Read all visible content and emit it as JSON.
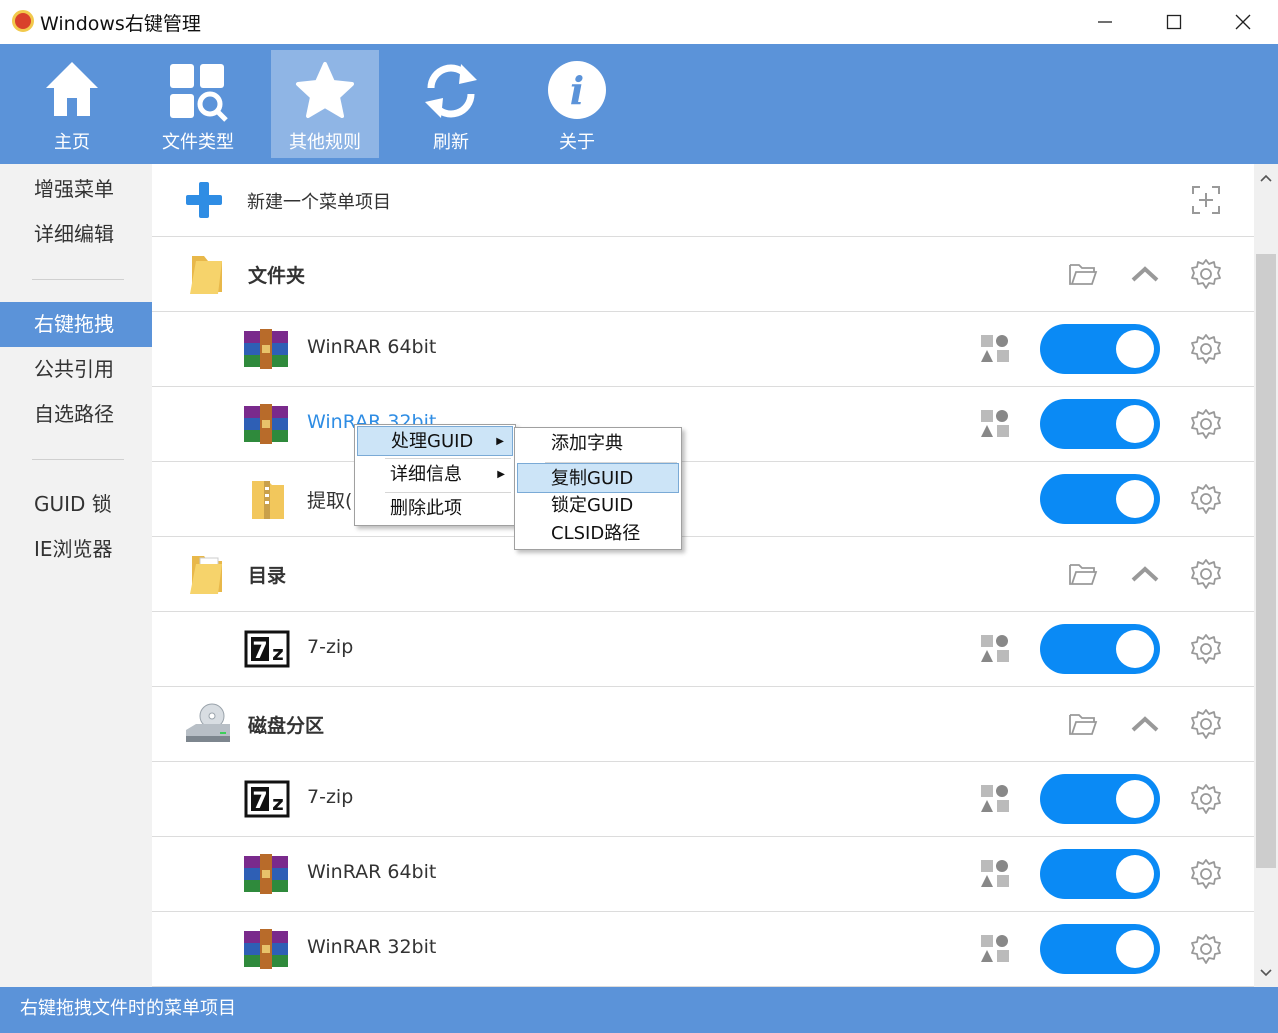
{
  "window": {
    "title": "Windows右键管理",
    "minimize": "—",
    "maximize": "☐",
    "close": "✕"
  },
  "toolbar": [
    {
      "label": "主页",
      "icon": "home-icon"
    },
    {
      "label": "文件类型",
      "icon": "file-types-icon"
    },
    {
      "label": "其他规则",
      "icon": "star-icon"
    },
    {
      "label": "刷新",
      "icon": "refresh-icon"
    },
    {
      "label": "关于",
      "icon": "info-icon"
    }
  ],
  "sidebar": {
    "items": [
      "增强菜单",
      "详细编辑",
      "右键拖拽",
      "公共引用",
      "自选路径",
      "GUID 锁",
      "IE浏览器"
    ],
    "active": "右键拖拽"
  },
  "main": {
    "new_item": "新建一个菜单项目",
    "rows": [
      {
        "type": "group",
        "label": "文件夹",
        "icon": "folder-icon"
      },
      {
        "type": "item",
        "label": "WinRAR 64bit",
        "icon": "winrar-icon",
        "enabled": true
      },
      {
        "type": "item",
        "label": "WinRAR 32bit",
        "icon": "winrar-icon",
        "enabled": true
      },
      {
        "type": "item",
        "label": "提取(E)",
        "icon": "zip-folder-icon",
        "enabled": true
      },
      {
        "type": "group",
        "label": "目录",
        "icon": "directory-icon"
      },
      {
        "type": "item",
        "label": "7-zip",
        "icon": "7zip-icon",
        "enabled": true
      },
      {
        "type": "group",
        "label": "磁盘分区",
        "icon": "disk-icon"
      },
      {
        "type": "item",
        "label": "7-zip",
        "icon": "7zip-icon",
        "enabled": true
      },
      {
        "type": "item",
        "label": "WinRAR 64bit",
        "icon": "winrar-icon",
        "enabled": true
      },
      {
        "type": "item",
        "label": "WinRAR 32bit",
        "icon": "winrar-icon",
        "enabled": true
      }
    ]
  },
  "context_menu": {
    "items": [
      {
        "label": "处理GUID",
        "submenu": true,
        "highlighted": true
      },
      {
        "label": "详细信息",
        "submenu": true
      },
      {
        "label": "删除此项",
        "submenu": false
      }
    ],
    "submenu": [
      {
        "label": "添加字典"
      },
      {
        "label": "复制GUID",
        "highlighted": true
      },
      {
        "label": "锁定GUID"
      },
      {
        "label": "CLSID路径"
      }
    ]
  },
  "status": {
    "text": "右键拖拽文件时的菜单项目"
  },
  "colors": {
    "accent": "#5b93d9",
    "toggle_on": "#0a8af5",
    "menu_highlight": "#cce4f7"
  }
}
